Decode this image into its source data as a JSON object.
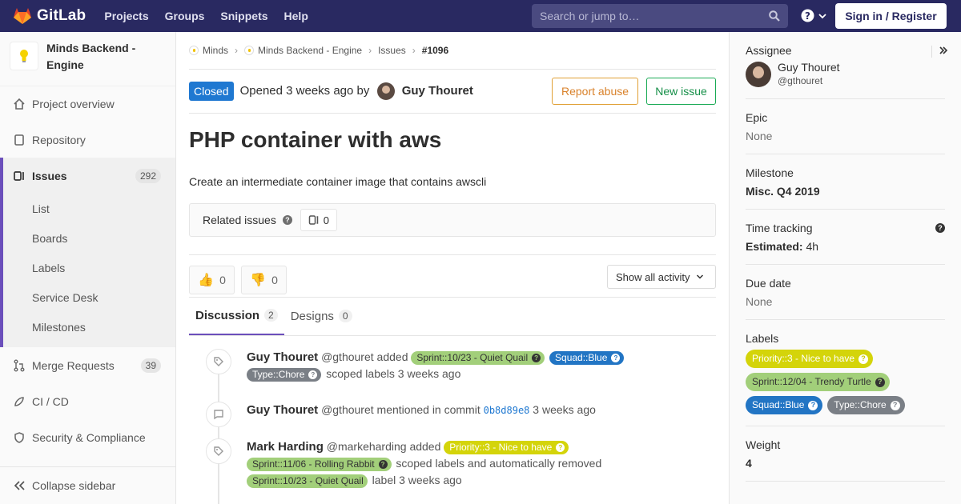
{
  "navbar": {
    "brand": "GitLab",
    "links": [
      "Projects",
      "Groups",
      "Snippets",
      "Help"
    ],
    "search_placeholder": "Search or jump to…",
    "signin_label": "Sign in / Register",
    "colors": {
      "bg": "#292961"
    }
  },
  "sidebar": {
    "project_name": "Minds Backend - Engine",
    "items": [
      {
        "label": "Project overview",
        "icon": "home-icon"
      },
      {
        "label": "Repository",
        "icon": "doc-icon"
      },
      {
        "label": "Issues",
        "icon": "issues-icon",
        "count": "292"
      },
      {
        "label": "Merge Requests",
        "icon": "merge-icon",
        "count": "39"
      },
      {
        "label": "CI / CD",
        "icon": "rocket-icon"
      },
      {
        "label": "Security & Compliance",
        "icon": "shield-icon"
      }
    ],
    "issue_sub": [
      "List",
      "Boards",
      "Labels",
      "Service Desk",
      "Milestones"
    ],
    "collapse_label": "Collapse sidebar"
  },
  "breadcrumb": [
    "Minds",
    "Minds Backend - Engine",
    "Issues",
    "#1096"
  ],
  "issue": {
    "status": "Closed",
    "opened_text": "Opened 3 weeks ago by",
    "author": "Guy Thouret",
    "report_label": "Report abuse",
    "new_label": "New issue",
    "title": "PHP container with aws",
    "description": "Create an intermediate container image that contains awscli",
    "related_label": "Related issues",
    "related_count": "0",
    "thumbs_up": "0",
    "thumbs_down": "0",
    "activity_filter": "Show all activity"
  },
  "tabs": [
    {
      "label": "Discussion",
      "count": "2"
    },
    {
      "label": "Designs",
      "count": "0"
    }
  ],
  "notes": [
    {
      "author": "Guy Thouret",
      "handle": "@gthouret",
      "action": "added",
      "tail": "scoped labels 3 weeks ago"
    },
    {
      "author": "Guy Thouret",
      "handle": "@gthouret",
      "action": "mentioned in commit",
      "commit": "0b8d89e8",
      "tail": "3 weeks ago"
    },
    {
      "author": "Mark Harding",
      "handle": "@markeharding",
      "action": "added",
      "mid": "scoped labels and automatically removed",
      "tail": "label 3 weeks ago"
    }
  ],
  "labels": {
    "sprint1023": "Sprint::10/23 - Quiet Quail",
    "squad_blue": "Squad::Blue",
    "type_chore": "Type::Chore",
    "priority3": "Priority::3 - Nice to have",
    "sprint1106": "Sprint::11/06 - Rolling Rabbit",
    "sprint1204": "Sprint::12/04 - Trendy Turtle"
  },
  "right_sidebar": {
    "assignee_title": "Assignee",
    "assignee_name": "Guy Thouret",
    "assignee_handle": "@gthouret",
    "epic_title": "Epic",
    "epic_value": "None",
    "milestone_title": "Milestone",
    "milestone_value": "Misc. Q4 2019",
    "time_title": "Time tracking",
    "estimated_label": "Estimated:",
    "estimated_value": "4h",
    "due_title": "Due date",
    "due_value": "None",
    "labels_title": "Labels",
    "weight_title": "Weight",
    "weight_value": "4"
  }
}
